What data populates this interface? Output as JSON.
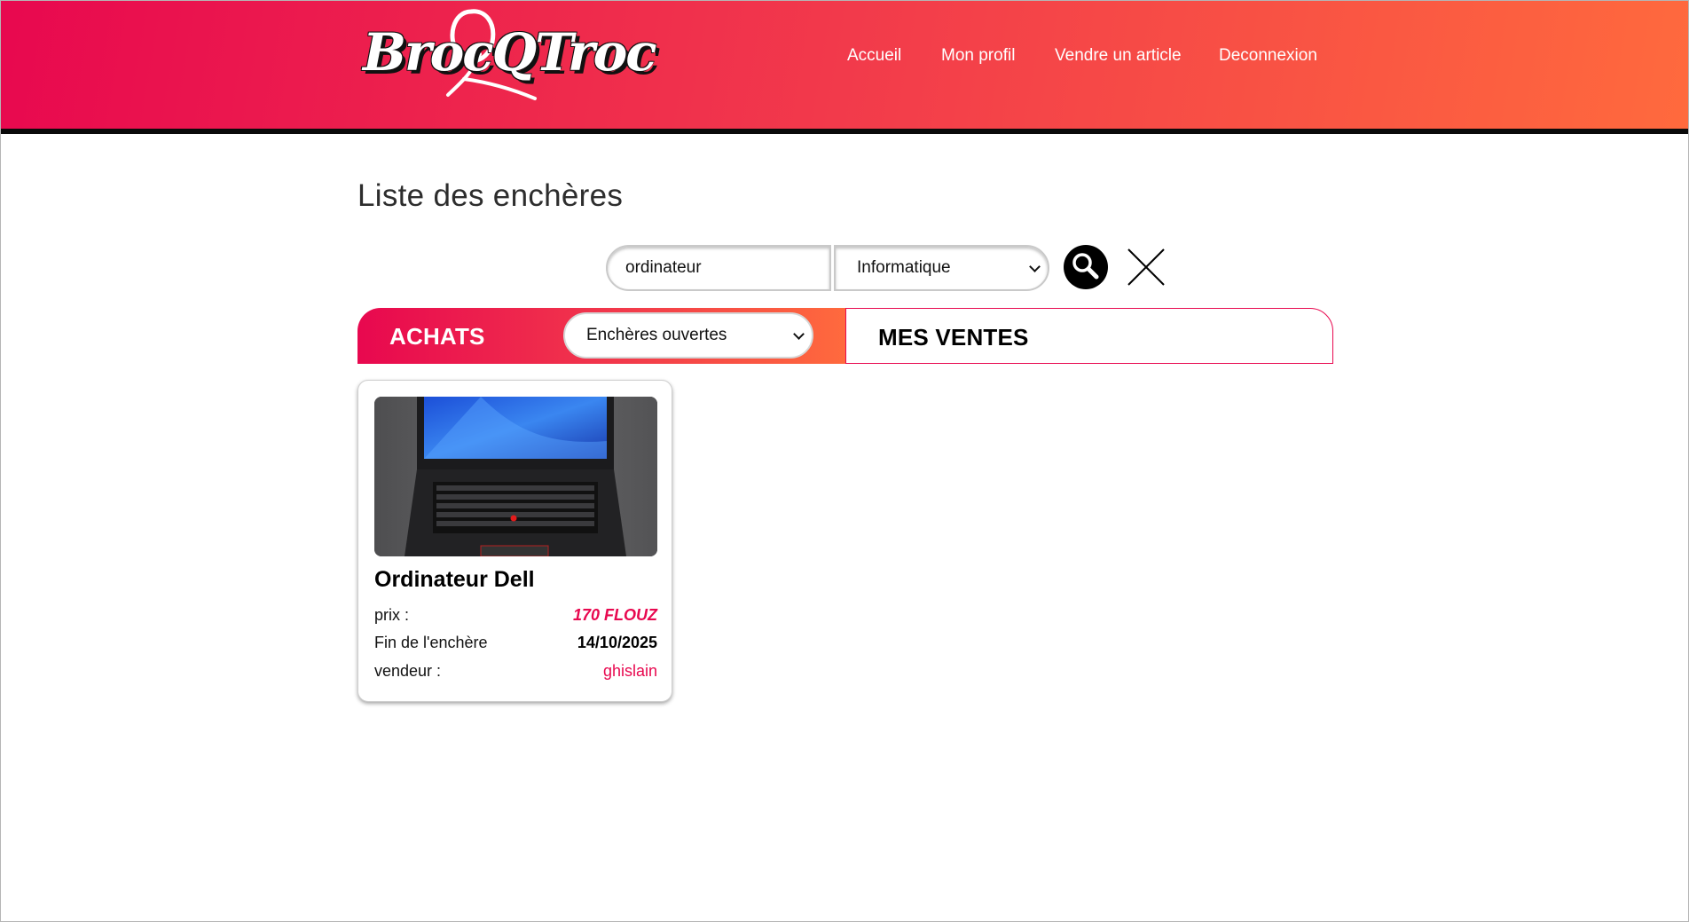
{
  "header": {
    "logo_text": "BrocQTroc",
    "nav": [
      {
        "label": "Accueil"
      },
      {
        "label": "Mon profil"
      },
      {
        "label": "Vendre un article"
      },
      {
        "label": "Deconnexion"
      }
    ]
  },
  "main": {
    "title": "Liste des enchères",
    "search": {
      "value": "ordinateur",
      "category_selected": "Informatique"
    },
    "tabs": {
      "achats_label": "ACHATS",
      "achats_filter_selected": "Enchères ouvertes",
      "ventes_label": "MES VENTES"
    },
    "cards": [
      {
        "title": "Ordinateur Dell",
        "price_label": "prix :",
        "price": "170 FLOUZ",
        "end_label": "Fin de l'enchère",
        "end_date": "14/10/2025",
        "seller_label": "vendeur :",
        "seller": "ghislain"
      }
    ]
  },
  "colors": {
    "brand_pink": "#e8084f",
    "brand_orange": "#ff6a3d"
  },
  "icons": {
    "search": "magnifier-icon",
    "clear": "close-icon"
  }
}
